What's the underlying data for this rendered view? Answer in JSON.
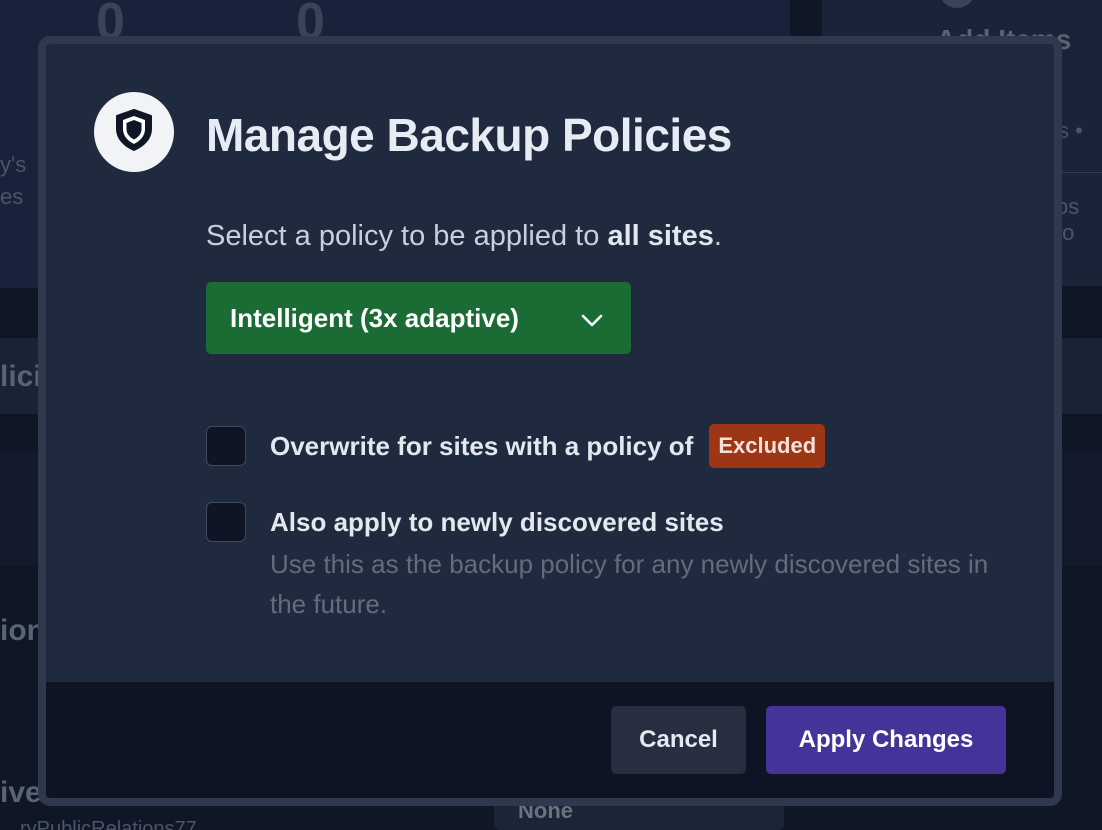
{
  "background": {
    "stat_1": "0",
    "stat_2": "0",
    "right_heading": "Add Items",
    "right_line_1": "s •",
    "right_line_2": "os fo",
    "left_line_1": "y's",
    "left_line_2": "es",
    "row_1_text": "lici",
    "row_2_text": "ion",
    "row_3_text": "ive",
    "row_3_sub": "ryPublicRelations77",
    "select_value": "None"
  },
  "modal": {
    "icon": "shield-icon",
    "title": "Manage Backup Policies",
    "subtitle_prefix": "Select a policy to be applied to ",
    "subtitle_bold": "all sites",
    "subtitle_suffix": ".",
    "policy_dropdown": {
      "selected": "Intelligent (3x adaptive)",
      "icon": "chevron-down-icon",
      "color": "#1a6b34"
    },
    "options": [
      {
        "label": "Overwrite for sites with a policy of",
        "badge": "Excluded",
        "badge_color": "#9c3614",
        "checked": false
      },
      {
        "label": "Also apply to newly discovered sites",
        "help": "Use this as the backup policy for any newly discovered sites in the future.",
        "checked": false
      }
    ],
    "footer": {
      "cancel_label": "Cancel",
      "apply_label": "Apply Changes",
      "apply_color": "#44349a"
    }
  }
}
